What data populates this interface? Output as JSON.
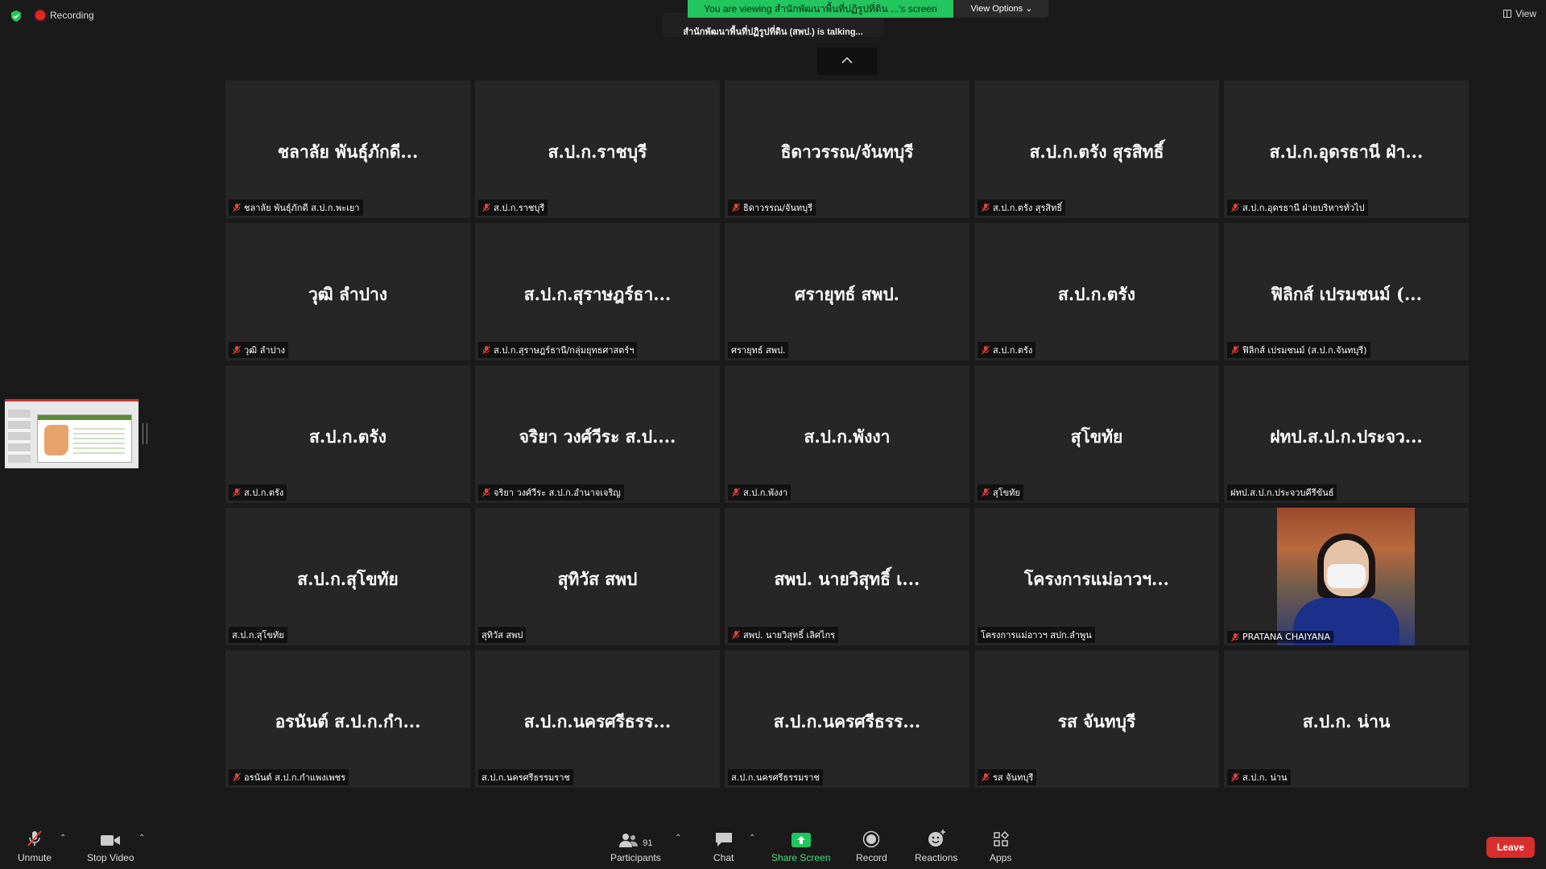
{
  "top": {
    "recording": "Recording",
    "banner": "You are viewing สำนักพัฒนาพื้นที่ปฏิรูปที่ดิน ...'s screen",
    "talking": "สำนักพัฒนาพื้นที่ปฏิรูปที่ดิน (สพป.) is talking...",
    "view_options": "View Options",
    "view": "View"
  },
  "tiles": [
    {
      "title": "ชลาลัย  พันธุ์ภักดี...",
      "label": "ชลาลัย  พันธุ์ภักดี ส.ป.ก.พะเยา",
      "muted": true
    },
    {
      "title": "ส.ป.ก.ราชบุรี",
      "label": "ส.ป.ก.ราชบุรี",
      "muted": true
    },
    {
      "title": "ธิดาวรรณ/จันทบุรี",
      "label": "ธิดาวรรณ/จันทบุรี",
      "muted": true
    },
    {
      "title": "ส.ป.ก.ตรัง สุรสิทธิ์",
      "label": "ส.ป.ก.ตรัง สุรสิทธิ์",
      "muted": true
    },
    {
      "title": "ส.ป.ก.อุดรธานี ฝ่า...",
      "label": "ส.ป.ก.อุดรธานี ฝ่ายบริหารทั่วไป",
      "muted": true
    },
    {
      "title": "วุฒิ ลำปาง",
      "label": "วุฒิ ลำปาง",
      "muted": true
    },
    {
      "title": "ส.ป.ก.สุราษฎร์ธา...",
      "label": "ส.ป.ก.สุราษฎร์ธานี/กลุ่มยุทธศาสตร์ฯ",
      "muted": true
    },
    {
      "title": "ศรายุทธ์ สพป.",
      "label": "ศรายุทธ์ สพป.",
      "muted": false
    },
    {
      "title": "ส.ป.ก.ตรัง",
      "label": "ส.ป.ก.ตรัง",
      "muted": true
    },
    {
      "title": "ฟิลิกส์ เปรมชนม์ (...",
      "label": "ฟิลิกส์ เปรมชนม์ (ส.ป.ก.จันทบุรี)",
      "muted": true
    },
    {
      "title": "ส.ป.ก.ตรัง",
      "label": "ส.ป.ก.ตรัง",
      "muted": true
    },
    {
      "title": "จริยา วงศ์วีระ ส.ป....",
      "label": "จริยา วงศ์วีระ ส.ป.ก.อำนาจเจริญ",
      "muted": true
    },
    {
      "title": "ส.ป.ก.พังงา",
      "label": "ส.ป.ก.พังงา",
      "muted": true
    },
    {
      "title": "สุโขทัย",
      "label": "สุโขทัย",
      "muted": true
    },
    {
      "title": "ฝทป.ส.ป.ก.ประจว...",
      "label": "ฝทป.ส.ป.ก.ประจวบคีรีขันธ์",
      "muted": false
    },
    {
      "title": "ส.ป.ก.สุโขทัย",
      "label": "ส.ป.ก.สุโขทัย",
      "muted": false
    },
    {
      "title": "สุทิวัส สพป",
      "label": "สุทิวัส สพป",
      "muted": false
    },
    {
      "title": "สพป. นายวิสุทธิ์  เ...",
      "label": "สพป. นายวิสุทธิ์  เลิศไกร",
      "muted": true
    },
    {
      "title": "โครงการแม่อาวฯ...",
      "label": "โครงการแม่อาวฯ สปก.ลำพูน",
      "muted": false
    },
    {
      "title": "",
      "label": "PRATANA  CHAIYANA",
      "muted": true,
      "video": true
    },
    {
      "title": "อรนันต์ ส.ป.ก.กำ...",
      "label": "อรนันต์ ส.ป.ก.กำแพงเพชร",
      "muted": true
    },
    {
      "title": "ส.ป.ก.นครศรีธรร...",
      "label": "ส.ป.ก.นครศรีธรรมราช",
      "muted": false
    },
    {
      "title": "ส.ป.ก.นครศรีธรร...",
      "label": "ส.ป.ก.นครศรีธรรมราช",
      "muted": false
    },
    {
      "title": "รส จันทบุรี",
      "label": "รส จันทบุรี",
      "muted": true
    },
    {
      "title": "ส.ป.ก. น่าน",
      "label": "ส.ป.ก. น่าน",
      "muted": true
    }
  ],
  "toolbar": {
    "unmute": "Unmute",
    "stop_video": "Stop Video",
    "participants": "Participants",
    "participants_count": "91",
    "chat": "Chat",
    "share_screen": "Share Screen",
    "record": "Record",
    "reactions": "Reactions",
    "apps": "Apps",
    "leave": "Leave"
  },
  "colors": {
    "accent_green": "#22c55e",
    "leave_red": "#d92d2d",
    "mute_red": "#e0443e"
  }
}
